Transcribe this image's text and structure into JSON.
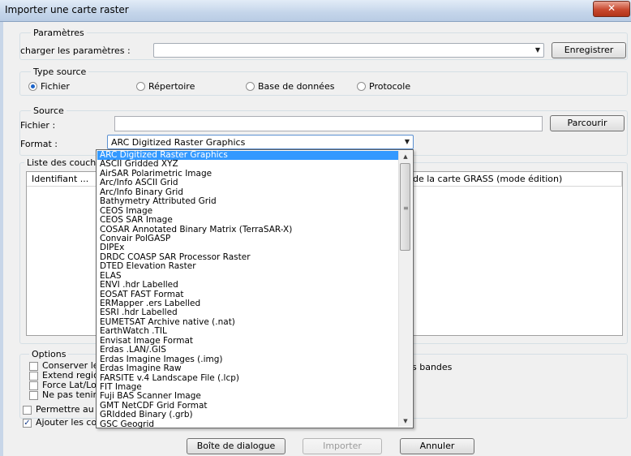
{
  "window": {
    "title": "Importer une carte raster",
    "close_icon": "close-icon"
  },
  "parametres": {
    "legend": "Paramètres",
    "load_label": "charger les paramètres :",
    "load_value": "",
    "save_button": "Enregistrer"
  },
  "type_source": {
    "legend": "Type source",
    "options": [
      {
        "label": "Fichier",
        "selected": true
      },
      {
        "label": "Répertoire",
        "selected": false
      },
      {
        "label": "Base de données",
        "selected": false
      },
      {
        "label": "Protocole",
        "selected": false
      }
    ]
  },
  "source": {
    "legend": "Source",
    "file_label": "Fichier :",
    "file_value": "",
    "browse_button": "Parcourir",
    "format_label": "Format :",
    "format_value": "ARC Digitized Raster Graphics"
  },
  "layers": {
    "legend": "Liste des couch",
    "columns": [
      "Identifiant ...",
      "de la carte GRASS (mode édition)"
    ]
  },
  "options": {
    "legend": "Options",
    "items": [
      {
        "label": "Conserver le",
        "checked": false
      },
      {
        "label": "Extend regio",
        "checked": false
      },
      {
        "label": "Force Lat/Lo",
        "checked": false
      },
      {
        "label": "Ne pas tenir",
        "checked": false
      }
    ],
    "bands_text": "s bandes",
    "permettre": {
      "label": "Permettre au",
      "checked": false
    },
    "ajouter": {
      "label": "Ajouter les co",
      "checked": true
    }
  },
  "format_dropdown": {
    "selected_index": 0,
    "items": [
      "ARC Digitized Raster Graphics",
      "ASCII Gridded XYZ",
      "AirSAR Polarimetric Image",
      "Arc/Info ASCII Grid",
      "Arc/Info Binary Grid",
      "Bathymetry Attributed Grid",
      "CEOS Image",
      "CEOS SAR Image",
      "COSAR Annotated Binary Matrix (TerraSAR-X)",
      "Convair PolGASP",
      "DIPEx",
      "DRDC COASP SAR Processor Raster",
      "DTED Elevation Raster",
      "ELAS",
      "ENVI .hdr Labelled",
      "EOSAT FAST Format",
      "ERMapper .ers Labelled",
      "ESRI .hdr Labelled",
      "EUMETSAT Archive native (.nat)",
      "EarthWatch .TIL",
      "Envisat Image Format",
      "Erdas .LAN/.GIS",
      "Erdas Imagine Images (.img)",
      "Erdas Imagine Raw",
      "FARSITE v.4 Landscape File (.lcp)",
      "FIT Image",
      "Fuji BAS Scanner Image",
      "GMT NetCDF Grid Format",
      "GRIdded Binary (.grb)",
      "GSC Geogrid"
    ]
  },
  "footer": {
    "dialog_button": "Boîte de dialogue",
    "import_button": "Importer",
    "cancel_button": "Annuler"
  }
}
